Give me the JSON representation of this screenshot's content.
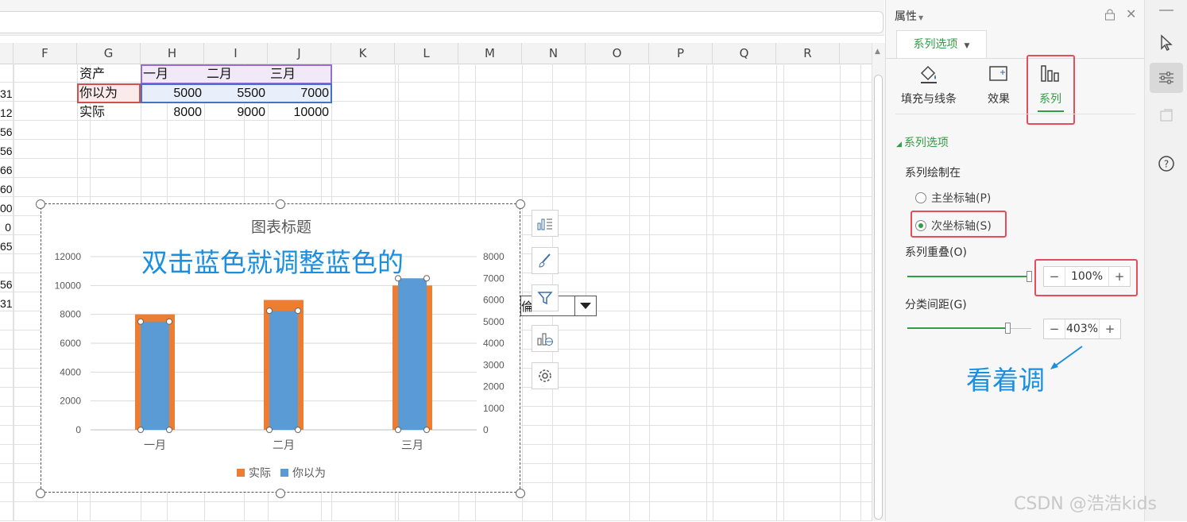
{
  "columns": [
    "F",
    "G",
    "H",
    "I",
    "J",
    "K",
    "L",
    "M",
    "N",
    "O",
    "P",
    "Q",
    "R"
  ],
  "edge_values": [
    "31",
    "12",
    "56",
    "56",
    "66",
    "60",
    "00",
    "0",
    "65",
    "",
    "56",
    "31"
  ],
  "table": {
    "header": [
      "资产",
      "一月",
      "二月",
      "三月"
    ],
    "rows": [
      {
        "label": "你以为",
        "values": [
          "5000",
          "5500",
          "7000"
        ]
      },
      {
        "label": "实际",
        "values": [
          "8000",
          "9000",
          "10000"
        ]
      }
    ]
  },
  "chart_data": {
    "type": "bar",
    "title": "图表标题",
    "categories": [
      "一月",
      "二月",
      "三月"
    ],
    "series": [
      {
        "name": "实际",
        "values": [
          8000,
          9000,
          10000
        ],
        "axis": "primary",
        "color": "#ed7d31"
      },
      {
        "name": "你以为",
        "values": [
          5000,
          5500,
          7000
        ],
        "axis": "secondary",
        "color": "#5b9bd5"
      }
    ],
    "ylim": [
      0,
      12000
    ],
    "y_ticks": [
      0,
      2000,
      4000,
      6000,
      8000,
      10000,
      12000
    ],
    "y2lim": [
      0,
      8000
    ],
    "y2_ticks": [
      0,
      1000,
      2000,
      3000,
      4000,
      5000,
      6000,
      7000,
      8000
    ],
    "legend_position": "bottom",
    "gridlines": true
  },
  "annotations": {
    "chart_note": "双击蓝色就调整蓝色的",
    "panel_note": "看着调"
  },
  "dropdown": {
    "value": "倫"
  },
  "panel": {
    "title": "属性",
    "tab_label": "系列选项",
    "subtabs": [
      "填充与线条",
      "效果",
      "系列"
    ],
    "section": "系列选项",
    "plot_on_label": "系列绘制在",
    "primary_axis": "主坐标轴(P)",
    "secondary_axis": "次坐标轴(S)",
    "overlap_label": "系列重叠(O)",
    "overlap_value": "100%",
    "overlap_fraction": 1.0,
    "gap_label": "分类间距(G)",
    "gap_value": "403%",
    "gap_fraction": 0.81
  },
  "colors": {
    "accent": "#2f9e44",
    "highlight": "#e64d5a",
    "annotation": "#1a8fe0"
  },
  "watermark": "CSDN @浩浩kids"
}
